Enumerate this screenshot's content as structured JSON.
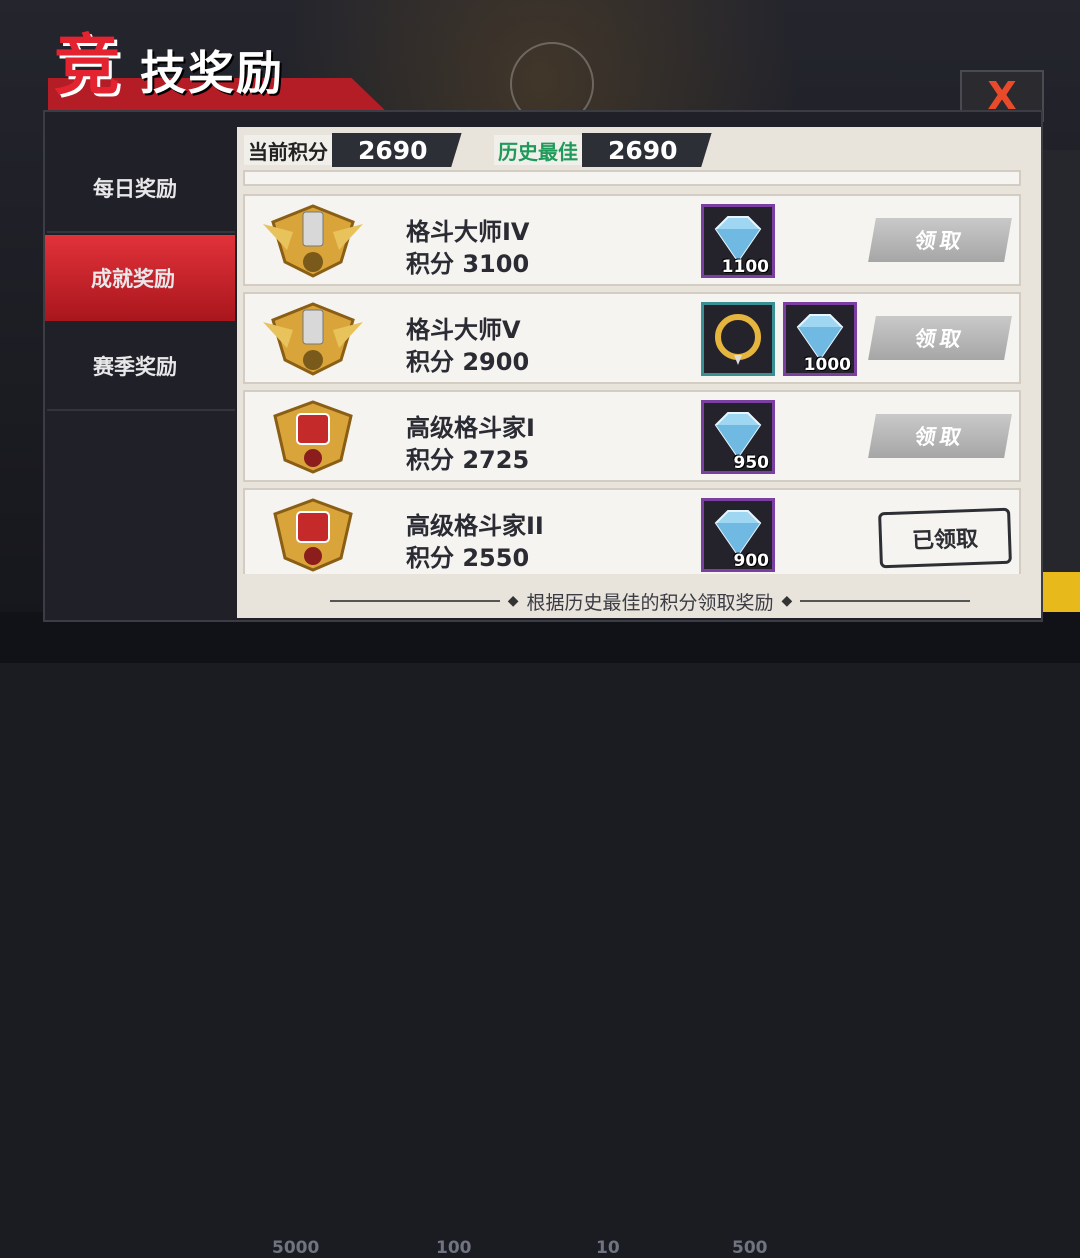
{
  "title": {
    "char1": "竞",
    "rest": "技奖励"
  },
  "close_label": "X",
  "sidebar": {
    "items": [
      {
        "label": "每日奖励",
        "active": false
      },
      {
        "label": "成就奖励",
        "active": true
      },
      {
        "label": "赛季奖励",
        "active": false
      }
    ]
  },
  "scores": {
    "current": {
      "label": "当前积分",
      "value": "2690"
    },
    "best": {
      "label": "历史最佳",
      "value": "2690"
    }
  },
  "rows": [
    {
      "name": "格斗大师IV",
      "points_label": "积分",
      "points": "3100",
      "badge": "gold-master-badge-icon",
      "rewards": [
        {
          "icon": "diamond-icon",
          "count": "1100"
        }
      ],
      "action": "领取",
      "claimed": false
    },
    {
      "name": "格斗大师V",
      "points_label": "积分",
      "points": "2900",
      "badge": "gold-master-badge-icon",
      "rewards": [
        {
          "icon": "gold-ring-icon",
          "count": ""
        },
        {
          "icon": "diamond-icon",
          "count": "1000"
        }
      ],
      "action": "领取",
      "claimed": false
    },
    {
      "name": "高级格斗家I",
      "points_label": "积分",
      "points": "2725",
      "badge": "red-fighter-badge-icon",
      "rewards": [
        {
          "icon": "diamond-icon",
          "count": "950"
        }
      ],
      "action": "领取",
      "claimed": false
    },
    {
      "name": "高级格斗家II",
      "points_label": "积分",
      "points": "2550",
      "badge": "red-fighter-badge-icon",
      "rewards": [
        {
          "icon": "diamond-icon",
          "count": "900"
        }
      ],
      "action": "已领取",
      "claimed": true
    }
  ],
  "footer": "根据历史最佳的积分领取奖励",
  "background": {
    "bottom_numbers": [
      "5000",
      "100",
      "10",
      "500"
    ]
  },
  "colors": {
    "accent_red": "#e42331",
    "panel": "#e8e3db",
    "diamond": "#9fd6f2"
  }
}
